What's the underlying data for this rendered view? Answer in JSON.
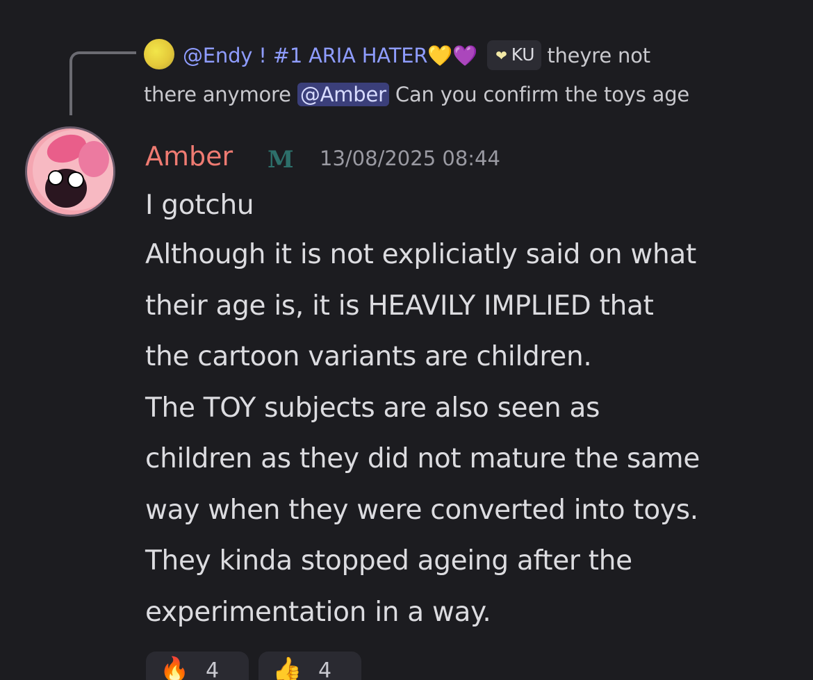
{
  "reply": {
    "author": "@Endy ! #1 ARIA HATER",
    "heart_1": "💛",
    "heart_2": "💜",
    "tag_icon": "❤",
    "tag": "KU",
    "text_1": "theyre not",
    "text_2": "there anymore",
    "mention": "@Amber",
    "text_3": "Can you confirm the toys age"
  },
  "message": {
    "author": "Amber",
    "role_icon": "M",
    "timestamp": "13/08/2025 08:44",
    "lines": [
      "I gotchu",
      "Although it is not expliciatly said on what",
      "their age is, it is HEAVILY IMPLIED that",
      "the cartoon variants are children.",
      "The TOY subjects are also seen as",
      "children as they did not mature the same",
      "way when they were converted into toys.",
      "They kinda stopped ageing after the",
      "experimentation in a way."
    ]
  },
  "reactions": [
    {
      "emoji": "🔥",
      "count": "4"
    },
    {
      "emoji": "👍",
      "count": "4"
    }
  ],
  "colors": {
    "background": "#1c1c20",
    "author_name": "#ef7b72",
    "reply_author": "#8f9dff",
    "mention_bg": "#3b3f7a",
    "text": "#dcdce0"
  }
}
